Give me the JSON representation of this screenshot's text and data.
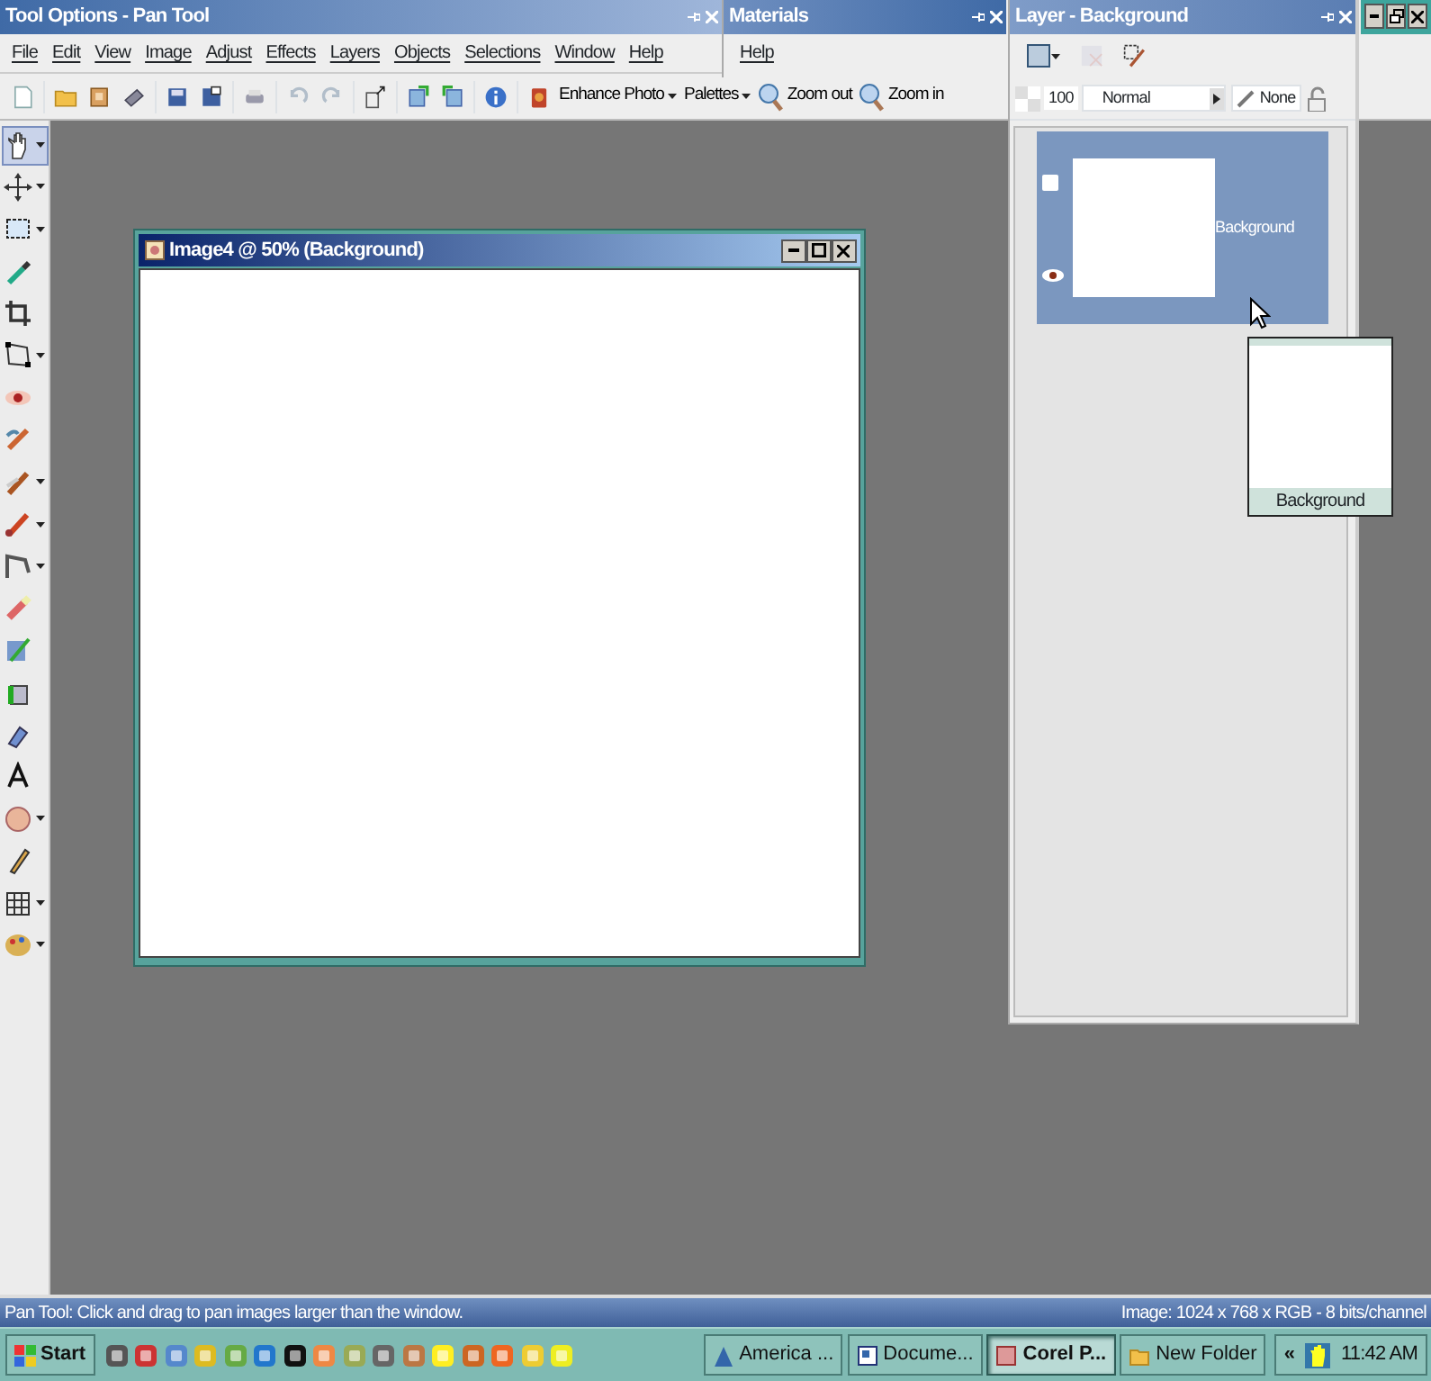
{
  "app_title": "Tool Options - Pan Tool",
  "menu": [
    "File",
    "Edit",
    "View",
    "Image",
    "Adjust",
    "Effects",
    "Layers",
    "Objects",
    "Selections",
    "Window",
    "Help"
  ],
  "materials": {
    "title": "Materials",
    "menu_item": "Help"
  },
  "toolbar": {
    "icon_buttons": [
      {
        "disabled": false
      },
      {
        "disabled": false
      },
      {
        "disabled": false
      },
      {
        "disabled": false
      },
      {
        "disabled": false
      },
      {
        "disabled": false
      },
      {
        "disabled": false
      },
      {
        "disabled": true
      },
      {
        "disabled": true
      },
      {
        "disabled": false
      },
      {
        "disabled": false
      },
      {
        "disabled": false
      },
      {
        "disabled": false
      },
      {
        "disabled": false
      }
    ],
    "buttons": [
      {
        "label": "Enhance Photo",
        "dropdown": true
      },
      {
        "label": "Palettes",
        "dropdown": true
      },
      {
        "label": "Zoom out",
        "dropdown": false
      },
      {
        "label": "Zoom in",
        "dropdown": false
      }
    ]
  },
  "toolbox": [
    {
      "selected": true,
      "dropdown": true
    },
    {
      "selected": false,
      "dropdown": true
    },
    {
      "selected": false,
      "dropdown": true
    },
    {
      "selected": false,
      "dropdown": false
    },
    {
      "selected": false,
      "dropdown": false
    },
    {
      "selected": false,
      "dropdown": true
    },
    {
      "selected": false,
      "dropdown": false
    },
    {
      "selected": false,
      "dropdown": false
    },
    {
      "selected": false,
      "dropdown": true
    },
    {
      "selected": false,
      "dropdown": true
    },
    {
      "selected": false,
      "dropdown": true
    },
    {
      "selected": false,
      "dropdown": false
    },
    {
      "selected": false,
      "dropdown": false
    },
    {
      "selected": false,
      "dropdown": false
    },
    {
      "selected": false,
      "dropdown": false
    },
    {
      "selected": false,
      "dropdown": false
    },
    {
      "selected": false,
      "dropdown": true
    },
    {
      "selected": false,
      "dropdown": false
    },
    {
      "selected": false,
      "dropdown": true
    },
    {
      "selected": false,
      "dropdown": true
    }
  ],
  "image_window": {
    "title": "Image4 @ 50% (Background)"
  },
  "layers": {
    "title": "Layer - Background",
    "opacity": "100",
    "blend_mode": "Normal",
    "mask": "None",
    "items": [
      {
        "name": "Background",
        "selected": true,
        "visible": true
      }
    ],
    "tooltip": "Background"
  },
  "status_bar": {
    "hint": "Pan Tool: Click and drag to pan images larger than the window.",
    "info": "Image:  1024 x 768 x RGB - 8 bits/channel"
  },
  "taskbar": {
    "start": "Start",
    "tasks": [
      {
        "label": "America ...",
        "selected": false
      },
      {
        "label": "Docume...",
        "selected": false
      },
      {
        "label": "Corel P...",
        "selected": true
      },
      {
        "label": "New Folder",
        "selected": false
      }
    ],
    "tray_toggle": "«",
    "clock": "11:42 AM"
  }
}
